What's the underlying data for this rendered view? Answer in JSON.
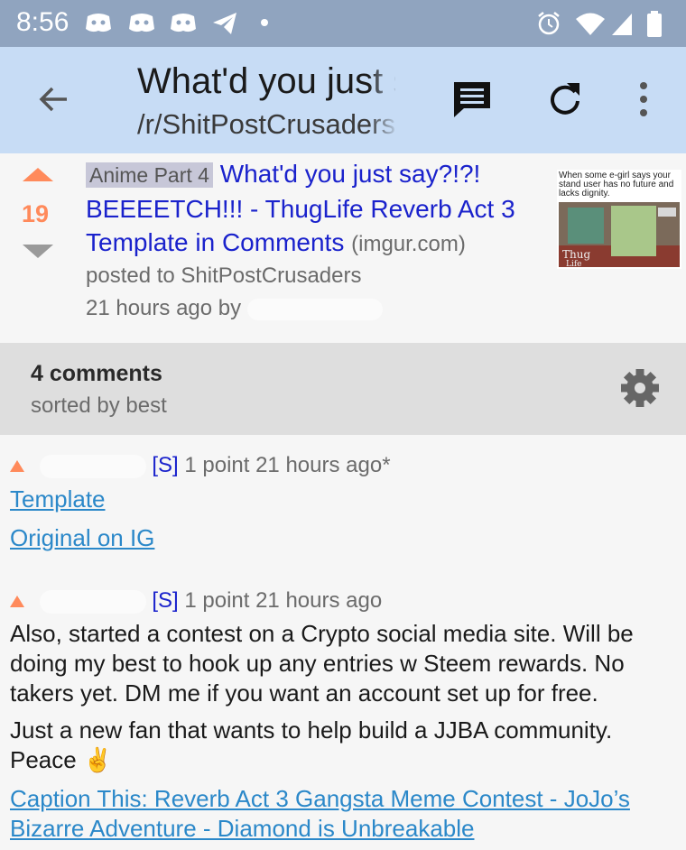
{
  "status_bar": {
    "time": "8:56",
    "icons": [
      "discord-icon",
      "discord-icon",
      "discord-icon",
      "telegram-icon",
      "dot-icon",
      "alarm-icon",
      "wifi-icon",
      "signal-icon",
      "battery-icon"
    ]
  },
  "app_bar": {
    "title": "What'd you just say?!?!",
    "subtitle": "/r/ShitPostCrusaders",
    "actions": [
      "back-arrow-icon",
      "comments-icon",
      "refresh-icon",
      "overflow-menu-icon"
    ]
  },
  "post": {
    "score": "19",
    "flair": "Anime Part 4",
    "title": "What'd you just say?!?! BEEEETCH!!! - ThugLife Reverb Act 3 Template in Comments",
    "domain": "(imgur.com)",
    "posted_to": "posted to ShitPostCrusaders",
    "time_by": "21 hours ago by",
    "thumbnail_caption": "When some e-girl says your stand user has no future and lacks dignity."
  },
  "comments_header": {
    "count": "4 comments",
    "sort": "sorted by best"
  },
  "comments": [
    {
      "submitter_tag": "[S]",
      "meta": "1 point 21 hours ago*",
      "links": [
        "Template",
        "Original on IG"
      ]
    },
    {
      "submitter_tag": "[S]",
      "meta": "1 point 21 hours ago",
      "para1": "Also, started a contest on a Crypto social media site. Will be doing my best to hook up any entries w Steem rewards. No takers yet. DM me if you want an account set up for free.",
      "para2": "Just a new fan that wants to help build a JJBA community. Peace ✌️",
      "link": "Caption This: Reverb Act 3 Gangsta Meme Contest - JoJo’s Bizarre Adventure - Diamond is Unbreakable"
    }
  ],
  "colors": {
    "status_bar": "#90a4bf",
    "app_bar": "#c7dcf5",
    "upvote": "#ff8a5b",
    "link": "#2b88c9",
    "title_link": "#1a22cc"
  }
}
